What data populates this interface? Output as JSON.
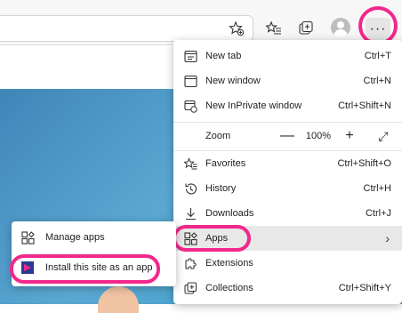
{
  "toolbar": {
    "icons": [
      "favorite-star-add-icon",
      "favorites-list-icon",
      "collections-icon",
      "profile-avatar-icon",
      "more-options-icon"
    ],
    "more_label": "···"
  },
  "menu": {
    "items": [
      {
        "label": "New tab",
        "shortcut": "Ctrl+T",
        "icon": "new-tab-icon"
      },
      {
        "label": "New window",
        "shortcut": "Ctrl+N",
        "icon": "new-window-icon"
      },
      {
        "label": "New InPrivate window",
        "shortcut": "Ctrl+Shift+N",
        "icon": "inprivate-icon"
      },
      {
        "label": "Favorites",
        "shortcut": "Ctrl+Shift+O",
        "icon": "favorites-icon"
      },
      {
        "label": "History",
        "shortcut": "Ctrl+H",
        "icon": "history-icon"
      },
      {
        "label": "Downloads",
        "shortcut": "Ctrl+J",
        "icon": "downloads-icon"
      },
      {
        "label": "Apps",
        "shortcut": "",
        "icon": "apps-icon"
      },
      {
        "label": "Extensions",
        "shortcut": "",
        "icon": "extensions-icon"
      },
      {
        "label": "Collections",
        "shortcut": "Ctrl+Shift+Y",
        "icon": "collections-icon"
      }
    ],
    "zoom": {
      "label": "Zoom",
      "value": "100%",
      "minus": "—",
      "plus": "+",
      "fullscreen": "⤢"
    }
  },
  "submenu": {
    "items": [
      {
        "label": "Manage apps",
        "icon": "manage-apps-icon"
      },
      {
        "label": "Install this site as an app",
        "icon": "install-app-icon"
      }
    ]
  },
  "colors": {
    "highlight_ring": "#f2278c",
    "page_art": "#4aa3cf",
    "menu_hover": "#e8e8e8"
  }
}
